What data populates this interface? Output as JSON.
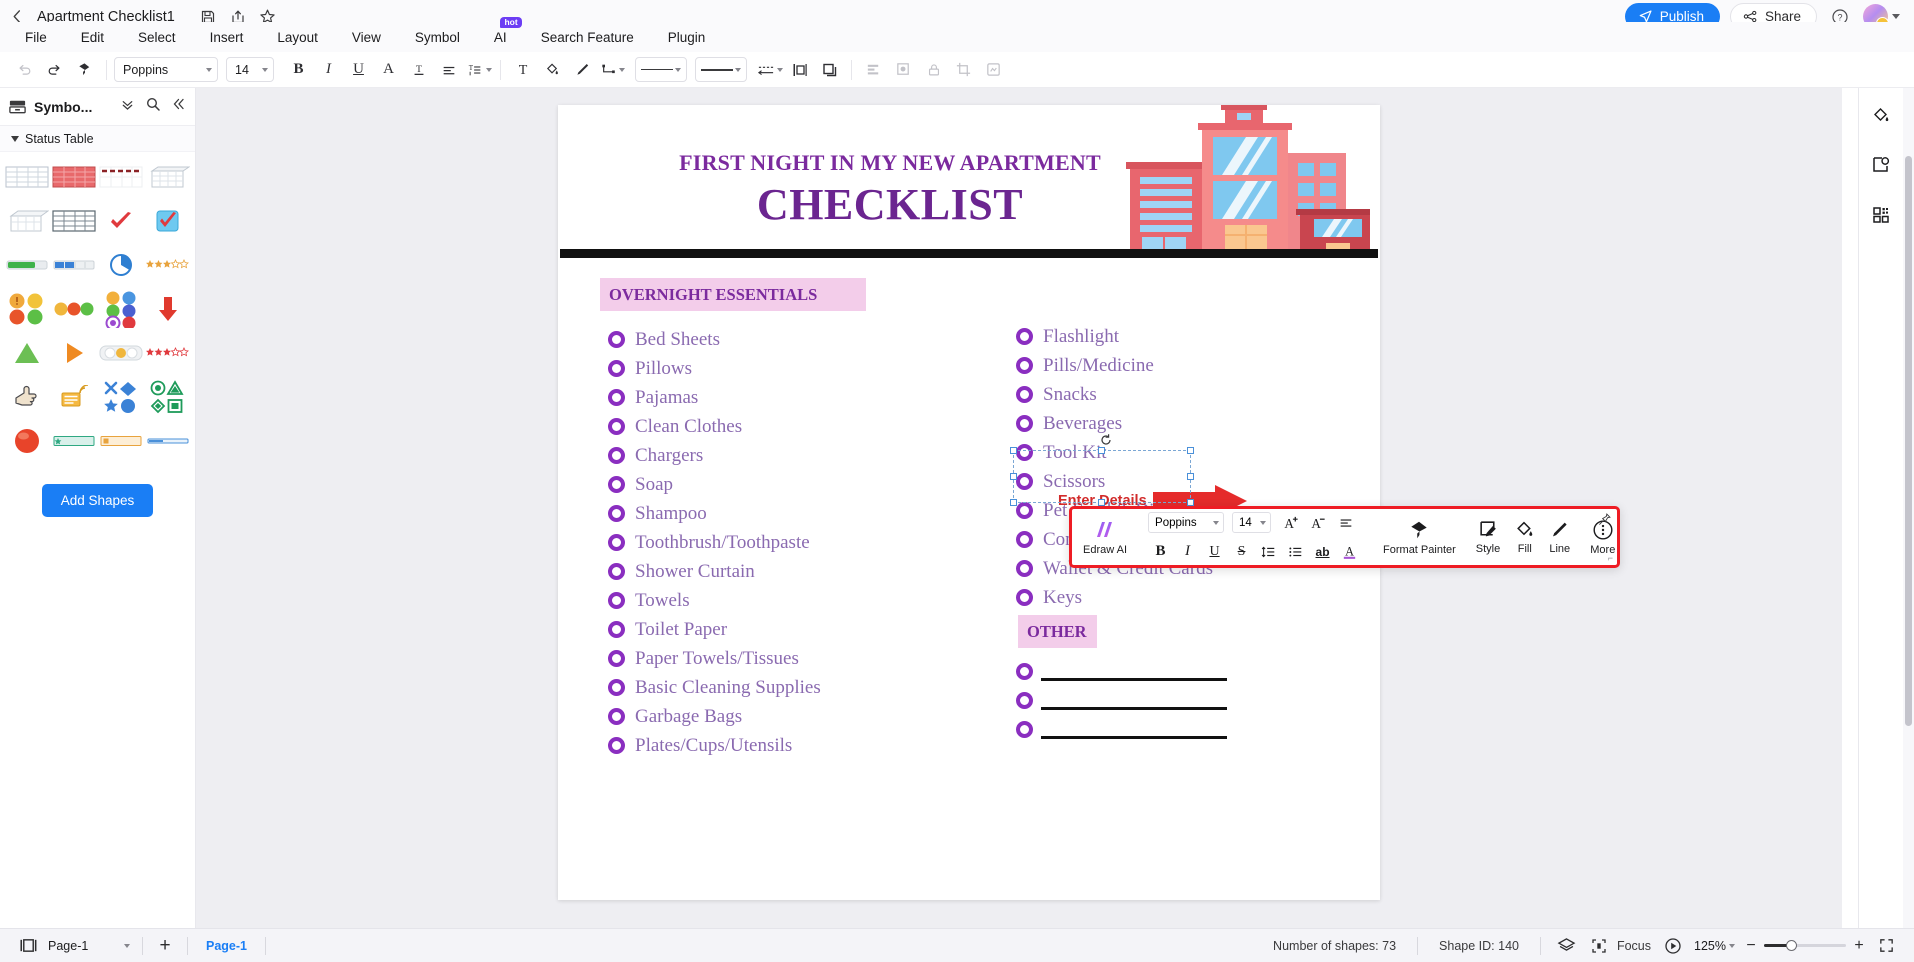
{
  "titlebar": {
    "back_icon": "chevron-left-icon",
    "doc_title": "Apartment Checklist1",
    "save_icon": "save-icon",
    "export_icon": "export-icon",
    "favorite_icon": "star-icon",
    "publish_label": "Publish",
    "publish_icon": "send-icon",
    "share_label": "Share",
    "share_icon": "share-nodes-icon",
    "help_icon": "question-circle-icon",
    "avatar_icon": "user-avatar",
    "accent_color": "#1a7ef5"
  },
  "menubar": {
    "items": [
      {
        "label": "File"
      },
      {
        "label": "Edit"
      },
      {
        "label": "Select"
      },
      {
        "label": "Insert"
      },
      {
        "label": "Layout"
      },
      {
        "label": "View"
      },
      {
        "label": "Symbol"
      },
      {
        "label": "AI",
        "badge": "hot"
      },
      {
        "label": "Search Feature"
      },
      {
        "label": "Plugin"
      }
    ]
  },
  "toolbar": {
    "undo_icon": "undo-icon",
    "redo_icon": "redo-icon",
    "format_painter_icon": "format-painter-icon",
    "font_family": "Poppins",
    "font_size": "14",
    "bold_label": "B",
    "italic_label": "I",
    "underline_label": "U",
    "font_color_label": "A",
    "text_style_label": "T",
    "align_icon": "align-left-icon",
    "line_spacing_icon": "line-spacing-icon",
    "text_box_icon": "text-box-icon",
    "fill_icon": "paint-bucket-icon",
    "line_icon": "pen-icon",
    "connector_icon": "connector-icon",
    "line_style_sample": "solid-line",
    "line_weight_sample": "solid-line",
    "line_arrow_icon": "dimension-icon",
    "align_objects_icon": "align-objects-icon",
    "group_icon": "group-icon",
    "distribute_icon": "distribute-icon",
    "shadow_icon": "shadow-icon",
    "lock_icon": "lock-icon",
    "crop_icon": "crop-icon",
    "layers_icon": "layers-icon"
  },
  "sidebar": {
    "panel_icon": "library-icon",
    "panel_title": "Symbo...",
    "expand_icon": "chevrons-down-icon",
    "search_icon": "search-icon",
    "collapse_icon": "chevrons-left-icon",
    "section_label": "Status Table",
    "add_shapes_label": "Add Shapes",
    "shape_rows": [
      [
        "table-grey-icon",
        "table-red-icon",
        "table-dashes-icon",
        "table-3d-icon"
      ],
      [
        "table-perspective-icon",
        "table-dark-icon",
        "checkmark-red-icon",
        "checkbox-checked-icon"
      ],
      [
        "progress-bar-green-icon",
        "progress-blocks-blue-icon",
        "pie-progress-icon",
        "rating-stars-icon"
      ],
      [
        "status-dots-4-icon",
        "status-dots-3-icon",
        "status-dots-6-icon",
        "down-arrow-red-icon"
      ],
      [
        "triangle-green-icon",
        "play-orange-icon",
        "traffic-light-icon",
        "rating-stars-red-icon"
      ],
      [
        "hand-point-icon",
        "signal-icon",
        "shapes-blue-icon",
        "shapes-green-icon"
      ],
      [
        "sphere-red-icon",
        "bar-teal-icon",
        "bar-orange-icon",
        "bar-blue-icon"
      ]
    ]
  },
  "canvas": {
    "document": {
      "heading_small": "FIRST NIGHT IN MY NEW APARTMENT",
      "heading_large": "CHECKLIST",
      "illustration": "apartment-building-illustration",
      "section_left_title": "OVERNIGHT ESSENTIALS",
      "section_other_title": "OTHER",
      "left_items": [
        "Bed Sheets",
        "Pillows",
        "Pajamas",
        "Clean Clothes",
        "Chargers",
        "Soap",
        "Shampoo",
        "Toothbrush/Toothpaste",
        "Shower Curtain",
        "Towels",
        "Toilet Paper",
        "Paper Towels/Tissues",
        "Basic Cleaning Supplies",
        "Garbage Bags",
        "Plates/Cups/Utensils"
      ],
      "right_items": [
        "Flashlight",
        "Pills/Medicine",
        "Snacks",
        "Beverages",
        "Tool Kit",
        "Scissors",
        "Pet Food & Dishes",
        "Contact Numbers",
        "Wallet & Credit Cards",
        "Keys"
      ],
      "other_blanks": 3,
      "title_color": "#6b2590",
      "banner_color": "#f3cdea",
      "bullet_color": "#8a2ec0",
      "item_text_color": "#8a6ab0"
    },
    "annotation": {
      "label": "Enter Details",
      "color": "#d22b2b",
      "arrow_icon": "right-arrow-annotation"
    },
    "selection": {
      "rotate_icon": "rotate-handle-icon",
      "handle_icon": "resize-handle"
    }
  },
  "floating_toolbar": {
    "ai_label": "Edraw AI",
    "ai_icon": "edraw-ai-icon",
    "font_family": "Poppins",
    "font_size": "14",
    "increase_font_icon": "increase-font-icon",
    "decrease_font_icon": "decrease-font-icon",
    "align_icon": "align-left-icon",
    "bold_label": "B",
    "italic_label": "I",
    "underline_label": "U",
    "strikethrough_label": "S",
    "line_spacing_icon": "line-spacing-icon",
    "bullet_list_icon": "bullet-list-icon",
    "highlight_label": "ab",
    "font_color_label": "A",
    "format_painter_label": "Format Painter",
    "format_painter_icon": "format-painter-icon",
    "style_label": "Style",
    "style_icon": "style-icon",
    "fill_label": "Fill",
    "fill_icon": "paint-bucket-icon",
    "line_label": "Line",
    "line_icon": "pen-icon",
    "more_label": "More",
    "more_icon": "more-circle-icon",
    "pin_icon": "pin-icon",
    "border_color": "#ee1c24"
  },
  "right_rail": {
    "items": [
      {
        "icon": "fill-color-icon"
      },
      {
        "icon": "image-settings-icon"
      },
      {
        "icon": "apps-grid-icon"
      }
    ]
  },
  "statusbar": {
    "page_view_icon": "page-view-icon",
    "page_selector": "Page-1",
    "add_page_icon": "plus-icon",
    "active_tab": "Page-1",
    "shape_count": "Number of shapes: 73",
    "shape_id": "Shape ID: 140",
    "layers_icon": "layers-icon",
    "focus_icon": "focus-frame-icon",
    "focus_label": "Focus",
    "presentation_icon": "play-circle-icon",
    "zoom_value": "125%",
    "zoom_out_icon": "minus-icon",
    "zoom_in_icon": "plus-icon",
    "fullscreen_icon": "fullscreen-icon"
  }
}
